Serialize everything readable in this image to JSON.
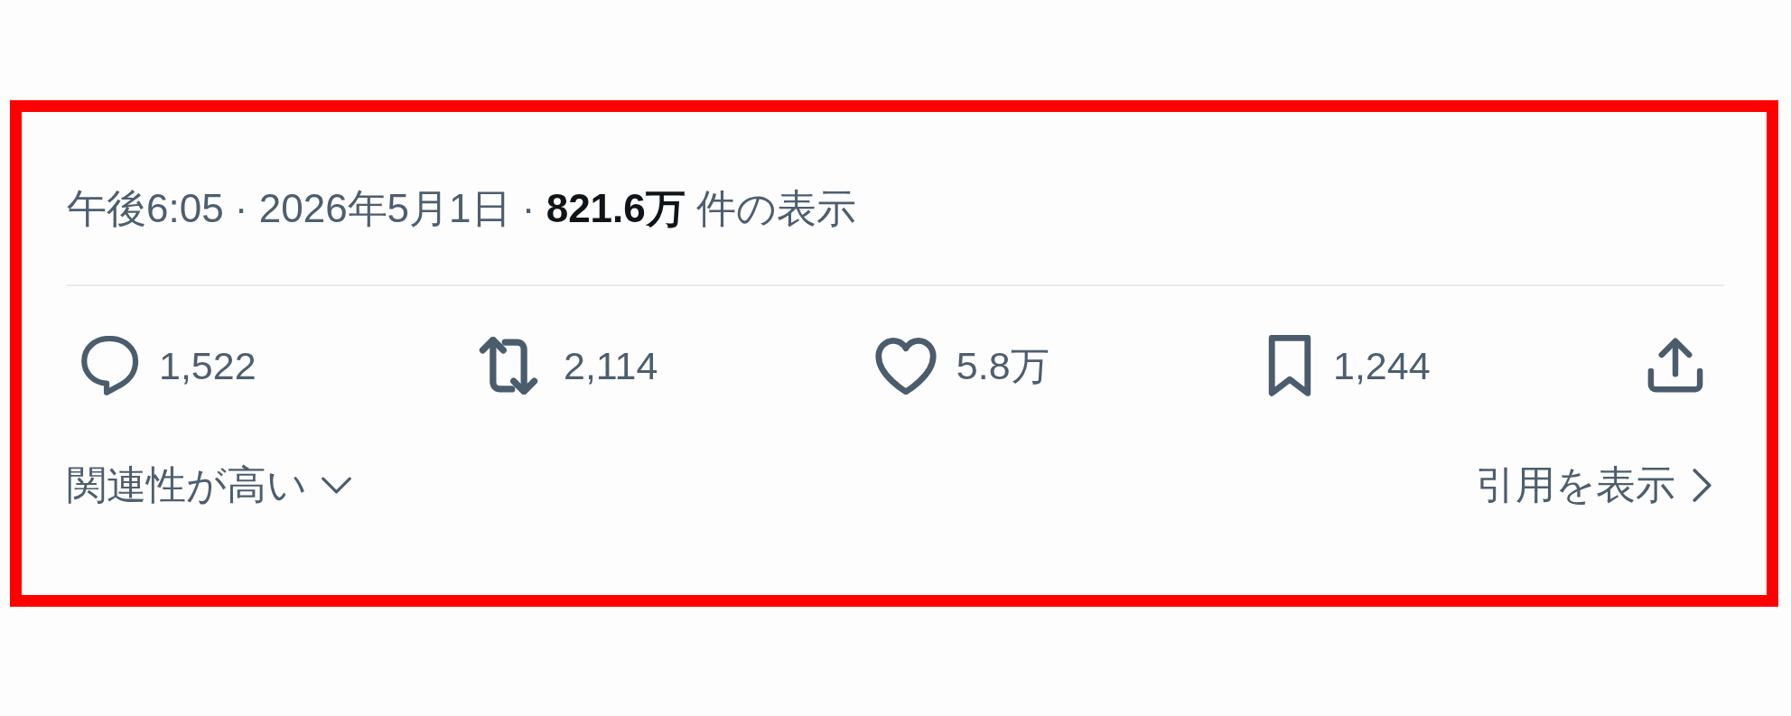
{
  "post_meta": {
    "text": "午後6:05 · 2026年5月1日 · **821.6万** 件の表示"
  },
  "actions": [
    {
      "kind": "reply",
      "count": "1,522"
    },
    {
      "kind": "repost",
      "count": "2,114"
    },
    {
      "kind": "like",
      "count": "5.8万"
    },
    {
      "kind": "bookmark",
      "count": "1,244"
    },
    {
      "kind": "share"
    }
  ],
  "sort_menu": {
    "label": "関連性が高い"
  },
  "quotes_link": {
    "label": "引用を表示"
  }
}
